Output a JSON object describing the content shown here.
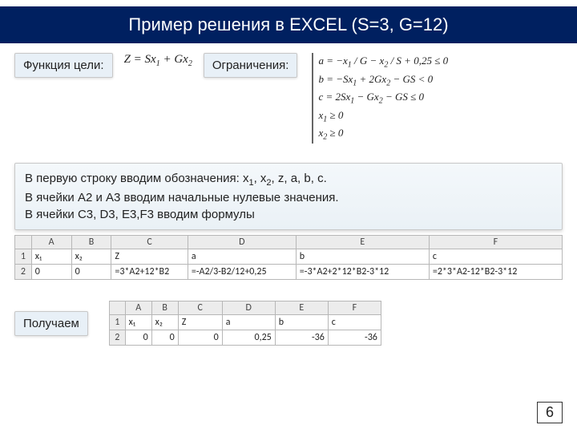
{
  "title": "Пример решения в EXCEL (S=3, G=12)",
  "labels": {
    "objective": "Функция цели:",
    "constraints": "Ограничения:",
    "result": "Получаем"
  },
  "objective_formula_html": "Z = Sx<sub>1</sub> + Gx<sub>2</sub>",
  "constraints_lines_html": [
    "a = −x<sub>1</sub> / G − x<sub>2</sub> / S + 0,25 ≤ 0",
    "b = −Sx<sub>1</sub> + 2Gx<sub>2</sub> − GS &lt; 0",
    "c = 2Sx<sub>1</sub> − Gx<sub>2</sub> − GS ≤ 0",
    "x<sub>1</sub> ≥ 0",
    "x<sub>2</sub> ≥ 0"
  ],
  "body_html": "В первую строку вводим обозначения: x<sub>1</sub>, x<sub>2</sub>, z, a, b, c.<br>В ячейки A2 и A3 вводим начальные нулевые значения.<br>В ячейки C3, D3, E3,F3 вводим формулы",
  "table1": {
    "cols": [
      "",
      "A",
      "B",
      "C",
      "D",
      "E",
      "F"
    ],
    "widths": [
      "20px",
      "48px",
      "48px",
      "92px",
      "130px",
      "160px",
      "160px"
    ],
    "rows": [
      [
        "1",
        "x₁",
        "x₂",
        "Z",
        "a",
        "b",
        "c"
      ],
      [
        "2",
        "0",
        "0",
        "=3*A2+12*B2",
        "=-A2/3-B2/12+0,25",
        "=-3*A2+2*12*B2-3*12",
        "=2*3*A2-12*B2-3*12"
      ]
    ]
  },
  "table2": {
    "cols": [
      "",
      "A",
      "B",
      "C",
      "D",
      "E",
      "F"
    ],
    "widths": [
      "18px",
      "30px",
      "30px",
      "50px",
      "60px",
      "60px",
      "60px"
    ],
    "rows": [
      [
        "1",
        "x₁",
        "x₂",
        "Z",
        "a",
        "b",
        "c"
      ],
      [
        "2",
        "0",
        "0",
        "0",
        "0,25",
        "-36",
        "-36"
      ]
    ]
  },
  "page_number": "6"
}
